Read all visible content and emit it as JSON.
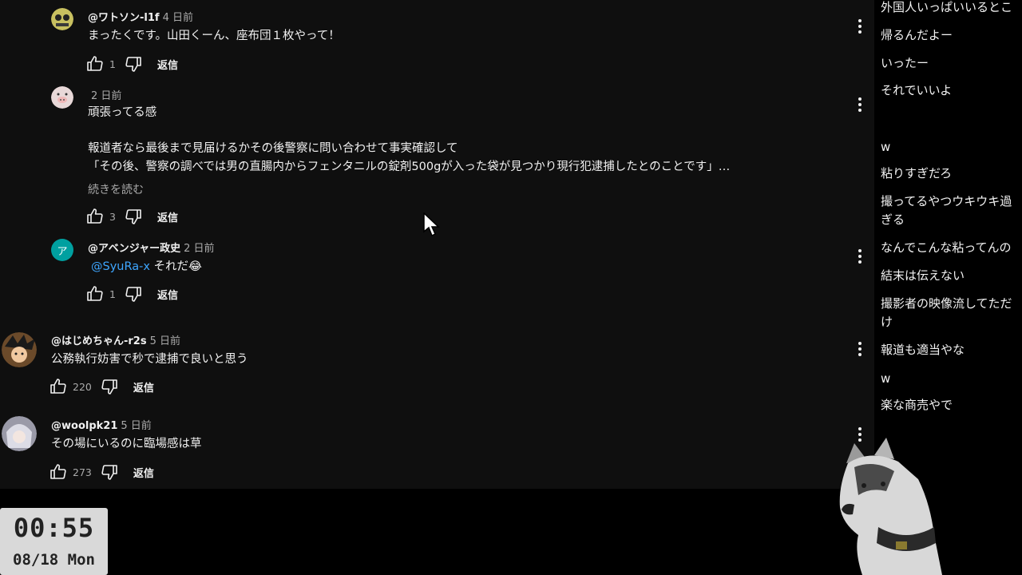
{
  "comments": [
    {
      "author": "@ワトソン-l1f",
      "time": "4 日前",
      "lines": [
        "まったくです。山田くーん、座布団１枚やって！"
      ],
      "likes": "1",
      "reply": "返信"
    },
    {
      "author": "",
      "time": "2 日前",
      "lines": [
        "頑張ってる感",
        "",
        "報道者なら最後まで見届けるかその後警察に問い合わせて事実確認して",
        "「その後、警察の調べでは男の直腸内からフェンタニルの錠剤500gが入った袋が見つかり現行犯逮捕したとのことです」…"
      ],
      "more": "続きを読む",
      "likes": "3",
      "reply": "返信"
    },
    {
      "author": "@アベンジャー政史",
      "time": "2 日前",
      "mention": "@SyuRa-x",
      "text_after": " それだ😂",
      "avatar_letter": "ア",
      "likes": "1",
      "reply": "返信"
    },
    {
      "author": "@はじめちゃん-r2s",
      "time": "5 日前",
      "lines": [
        "公務執行妨害で秒で逮捕で良いと思う"
      ],
      "likes": "220",
      "reply": "返信"
    },
    {
      "author": "@woolpk21",
      "time": "5 日前",
      "lines": [
        "その場にいるのに臨場感は草"
      ],
      "likes": "273",
      "reply": "返信"
    }
  ],
  "chat": [
    "外国人いっぱいいるとこ",
    "帰るんだよー",
    "いったー",
    "それでいいよ",
    "w",
    "粘りすぎだろ",
    "撮ってるやつウキウキ過\nぎる",
    "なんでこんな粘ってんの",
    "結末は伝えない",
    "撮影者の映像流してただ\nけ",
    "報道も適当やな",
    "w",
    "楽な商売やで"
  ],
  "clock": {
    "time": "00:55",
    "date": "08/18 Mon"
  },
  "colors": {
    "background": "#0f0f0f",
    "link": "#3ea6ff",
    "avatar_teal": "#00a0a0"
  }
}
